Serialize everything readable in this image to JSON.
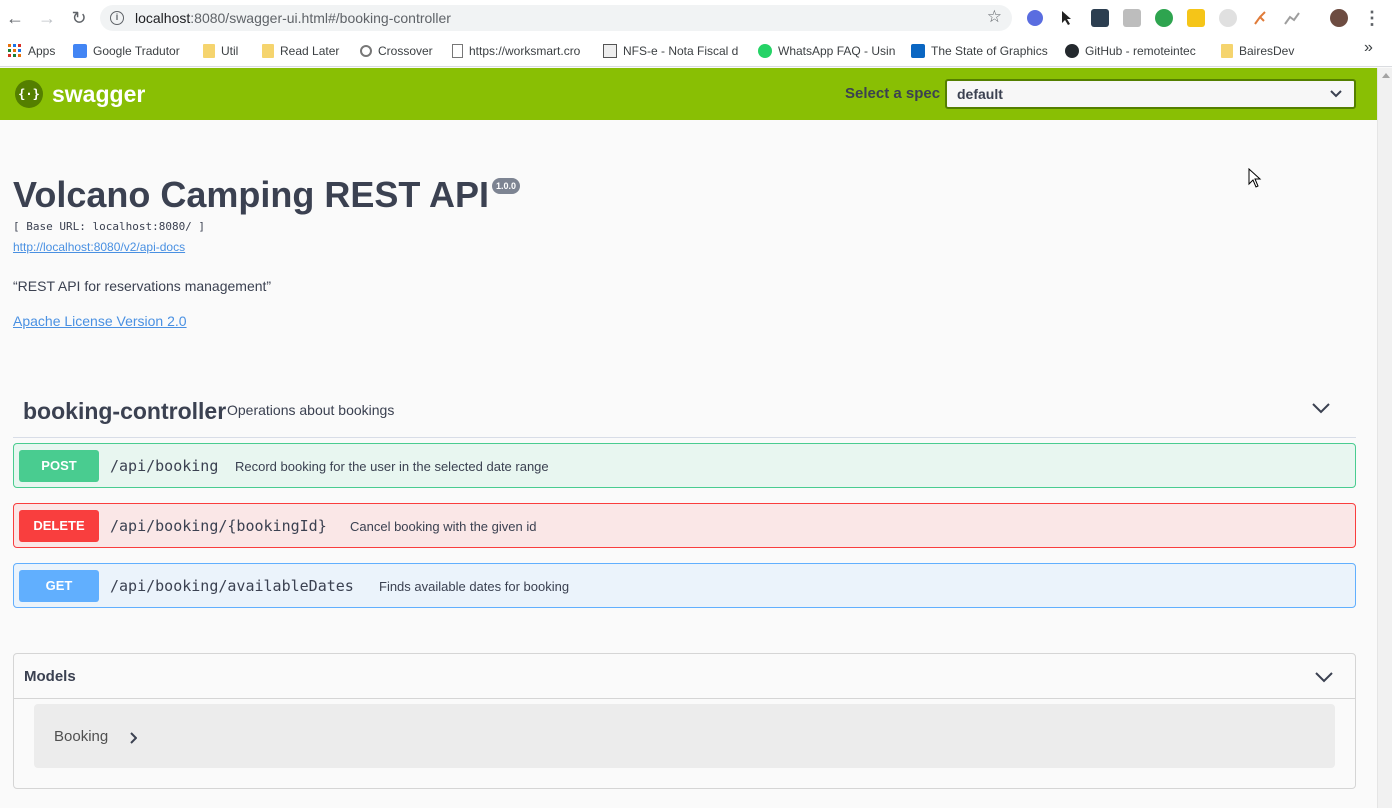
{
  "browser": {
    "url_host": "localhost",
    "url_rest": ":8080/swagger-ui.html#/booking-controller",
    "bookmarks": [
      "Apps",
      "Google Tradutor",
      "Util",
      "Read Later",
      "Crossover",
      "https://worksmart.cro",
      "NFS-e - Nota Fiscal d",
      "WhatsApp FAQ - Usin",
      "The State of Graphics",
      "GitHub - remoteintec",
      "BairesDev"
    ],
    "overflow": "»"
  },
  "topbar": {
    "logo_text": "swagger",
    "spec_label": "Select a spec",
    "spec_value": "default"
  },
  "info": {
    "title": "Volcano Camping REST API",
    "version": "1.0.0",
    "base_url": "[ Base URL: localhost:8080/ ]",
    "api_docs": "http://localhost:8080/v2/api-docs",
    "description": "“REST API for reservations management”",
    "license": "Apache License Version 2.0"
  },
  "controller": {
    "name": "booking-controller",
    "description": "Operations about bookings",
    "operations": [
      {
        "method": "POST",
        "path": "/api/booking",
        "summary": "Record booking for the user in the selected date range"
      },
      {
        "method": "DELETE",
        "path": "/api/booking/{bookingId}",
        "summary": "Cancel booking with the given id"
      },
      {
        "method": "GET",
        "path": "/api/booking/availableDates",
        "summary": "Finds available dates for booking"
      }
    ]
  },
  "models": {
    "title": "Models",
    "items": [
      "Booking"
    ]
  },
  "colors": {
    "topbar": "#89bf04",
    "post": "#49cc90",
    "delete": "#f93e3e",
    "get": "#61affe",
    "link": "#4990e2"
  }
}
